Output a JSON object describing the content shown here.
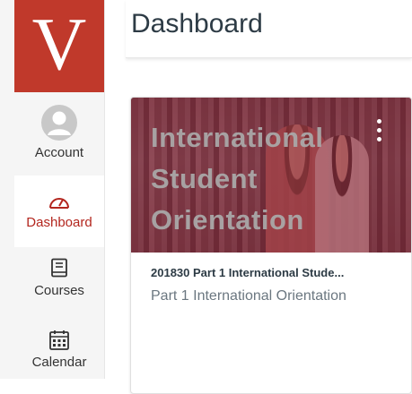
{
  "logo": {
    "letter": "V",
    "color": "#c0392b"
  },
  "nav": {
    "account": {
      "label": "Account",
      "icon": "avatar-icon"
    },
    "dashboard": {
      "label": "Dashboard",
      "icon": "speedometer-icon",
      "active": true
    },
    "courses": {
      "label": "Courses",
      "icon": "book-icon"
    },
    "calendar": {
      "label": "Calendar",
      "icon": "calendar-icon"
    }
  },
  "header": {
    "title": "Dashboard"
  },
  "card": {
    "hero_title": "International Student Orientation",
    "hero_color": "#8b1e2e",
    "course_code": "201830 Part 1 International Stude...",
    "course_name": "Part 1 International Orientation",
    "menu_icon": "kebab-menu-icon"
  },
  "accent_color": "#b3261e"
}
